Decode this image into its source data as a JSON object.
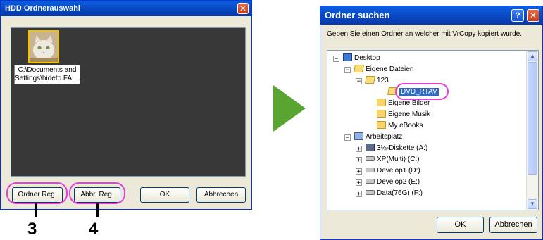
{
  "left_dialog": {
    "title": "HDD Ordnerauswahl",
    "close_glyph": "✕",
    "thumbnail_label_line1": "C:\\Documents and",
    "thumbnail_label_line2": "Settings\\hideto.FAL...",
    "buttons": {
      "ordner_reg": "Ordner Reg.",
      "abbr_reg": "Abbr. Reg.",
      "ok": "OK",
      "abbrechen": "Abbrechen"
    }
  },
  "callouts": {
    "three": "3",
    "four": "4"
  },
  "right_dialog": {
    "title": "Ordner suchen",
    "help_glyph": "?",
    "close_glyph": "✕",
    "description": "Geben Sie einen Ordner an welcher mit VrCopy kopiert wurde.",
    "tree": {
      "desktop": "Desktop",
      "eigene_dateien": "Eigene Dateien",
      "f123": "123",
      "dvd_rtav": "DVD_RTAV",
      "eigene_bilder": "Eigene Bilder",
      "eigene_musik": "Eigene Musik",
      "my_ebooks": "My eBooks",
      "arbeitsplatz": "Arbeitsplatz",
      "diskette": "3½-Diskette (A:)",
      "xp_multi": "XP(Multi) (C:)",
      "develop1": "Develop1 (D:)",
      "develop2": "Develop2 (E:)",
      "data76g": "Data(76G) (F:)"
    },
    "buttons": {
      "ok": "OK",
      "abbrechen": "Abbrechen"
    }
  },
  "colors": {
    "highlight": "#e53ee0",
    "titlebar": "#0a49c4",
    "arrow": "#5aa532",
    "selection": "#316ac5"
  }
}
